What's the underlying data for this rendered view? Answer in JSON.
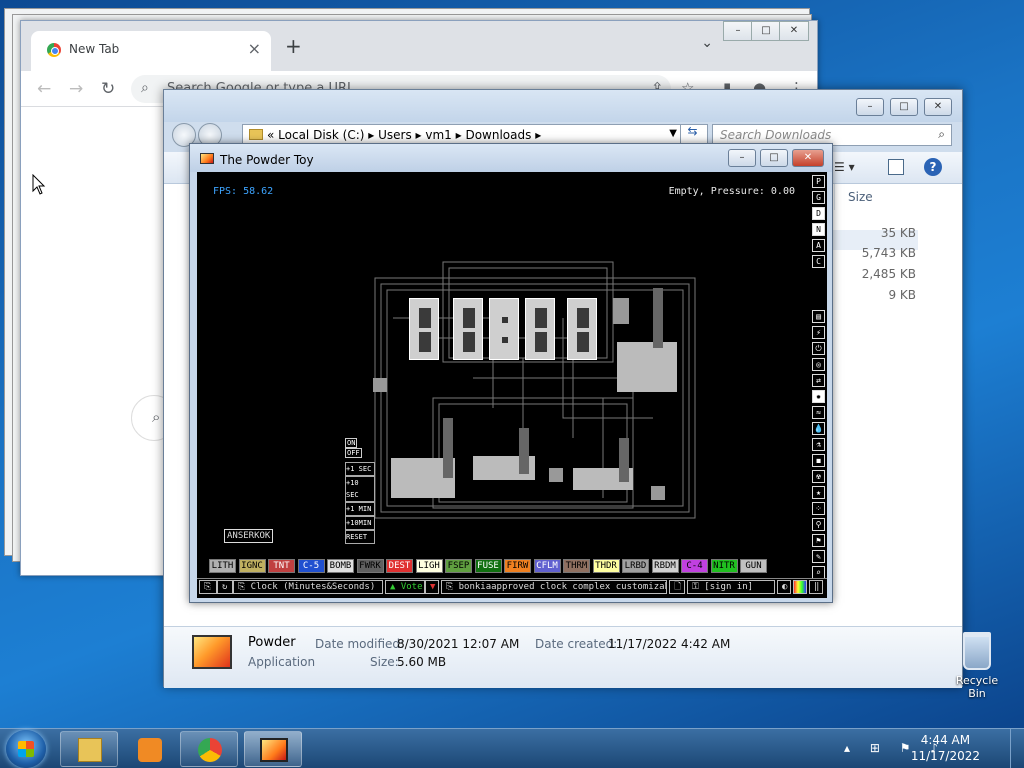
{
  "chrome": {
    "tab_title": "New Tab",
    "omnibox_placeholder": "Search Google or type a URL"
  },
  "explorer": {
    "breadcrumb": [
      "Local Disk (C:)",
      "Users",
      "vm1",
      "Downloads"
    ],
    "search_placeholder": "Search Downloads",
    "column_size": "Size",
    "sizes": [
      "35 KB",
      "5,743 KB",
      "2,485 KB",
      "9 KB"
    ],
    "details": {
      "name": "Powder",
      "type": "Application",
      "date_modified_label": "Date modified:",
      "date_modified": "8/30/2021 12:07 AM",
      "size_label": "Size:",
      "size": "5.60 MB",
      "date_created_label": "Date created:",
      "date_created": "11/17/2022 4:42 AM"
    }
  },
  "powder_toy": {
    "title": "The Powder Toy",
    "fps": "FPS: 58.62",
    "status": "Empty, Pressure: 0.00",
    "right_top_buttons": [
      "P",
      "G",
      "D",
      "N",
      "A",
      "C"
    ],
    "elements": [
      {
        "label": "LITH",
        "bg": "#b0b0b0",
        "fg": "#000"
      },
      {
        "label": "IGNC",
        "bg": "#c0b060",
        "fg": "#000"
      },
      {
        "label": "TNT",
        "bg": "#c04040",
        "fg": "#fff"
      },
      {
        "label": "C-5",
        "bg": "#2050d0",
        "fg": "#fff"
      },
      {
        "label": "BOMB",
        "bg": "#e0e0e0",
        "fg": "#000"
      },
      {
        "label": "FWRK",
        "bg": "#606060",
        "fg": "#000"
      },
      {
        "label": "DEST",
        "bg": "#e03030",
        "fg": "#fff"
      },
      {
        "label": "LIGH",
        "bg": "#ffffe0",
        "fg": "#000"
      },
      {
        "label": "FSEP",
        "bg": "#60a040",
        "fg": "#000"
      },
      {
        "label": "FUSE",
        "bg": "#107010",
        "fg": "#fff"
      },
      {
        "label": "FIRW",
        "bg": "#f08020",
        "fg": "#000"
      },
      {
        "label": "CFLM",
        "bg": "#6060d0",
        "fg": "#fff"
      },
      {
        "label": "THRM",
        "bg": "#907060",
        "fg": "#000"
      },
      {
        "label": "THDR",
        "bg": "#ffffa0",
        "fg": "#000"
      },
      {
        "label": "LRBD",
        "bg": "#a0a0a0",
        "fg": "#000"
      },
      {
        "label": "RBDM",
        "bg": "#d0d0d0",
        "fg": "#000"
      },
      {
        "label": "C-4",
        "bg": "#c040e0",
        "fg": "#000"
      },
      {
        "label": "NITR",
        "bg": "#20c020",
        "fg": "#000"
      },
      {
        "label": "GUN",
        "bg": "#c0c0c0",
        "fg": "#000"
      }
    ],
    "save_name": "Clock (Minutes&Seconds)",
    "vote_label": "Vote",
    "tags": "bonkiaapproved clock complex customizab...",
    "sign_in": "[sign in]",
    "clock_buttons": [
      "ON",
      "OFF"
    ],
    "panel_labels": [
      "+1 SEC",
      "+10 SEC",
      "+1 MIN",
      "+10MIN",
      "RESET"
    ],
    "author_tag": "ANSERKOK"
  },
  "desktop": {
    "recycle_bin": "Recycle Bin"
  },
  "taskbar": {
    "time": "4:44 AM",
    "date": "11/17/2022"
  }
}
